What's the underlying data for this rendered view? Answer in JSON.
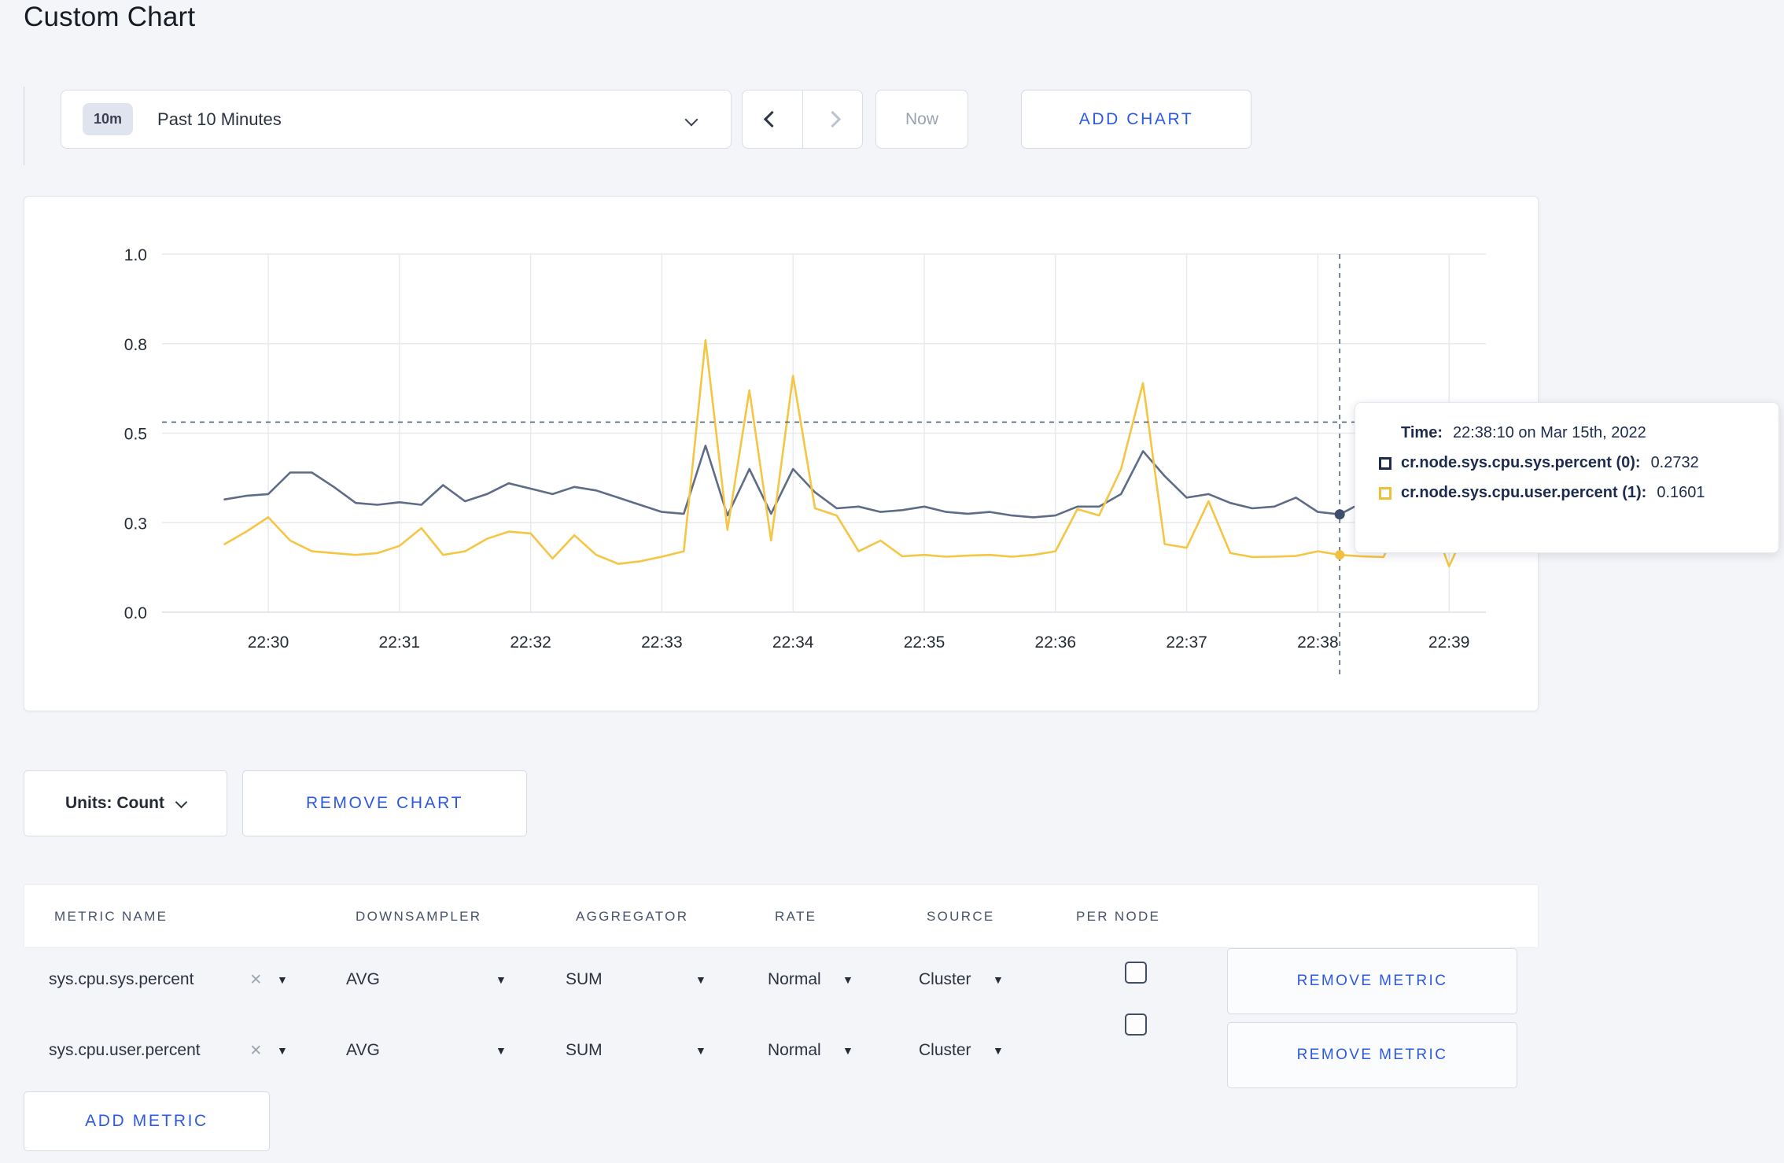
{
  "page": {
    "title": "Custom Chart"
  },
  "toolbar": {
    "time_picker": {
      "badge": "10m",
      "label": "Past 10 Minutes"
    },
    "now_label": "Now",
    "add_chart_label": "ADD CHART"
  },
  "chart_controls": {
    "units_label": "Units: Count",
    "remove_chart_label": "REMOVE CHART"
  },
  "icons": {
    "caret_down": "▼",
    "close": "×"
  },
  "metrics_table": {
    "headers": [
      "METRIC NAME",
      "DOWNSAMPLER",
      "AGGREGATOR",
      "RATE",
      "SOURCE",
      "PER NODE"
    ],
    "rows": [
      {
        "metric": "sys.cpu.sys.percent",
        "downsampler": "AVG",
        "aggregator": "SUM",
        "rate": "Normal",
        "source": "Cluster",
        "per_node_checked": false,
        "remove_label": "REMOVE METRIC"
      },
      {
        "metric": "sys.cpu.user.percent",
        "downsampler": "AVG",
        "aggregator": "SUM",
        "rate": "Normal",
        "source": "Cluster",
        "per_node_checked": false,
        "remove_label": "REMOVE METRIC"
      }
    ],
    "add_metric_label": "ADD METRIC"
  },
  "chart_data": {
    "type": "line",
    "title": "",
    "xlabel": "",
    "ylabel": "",
    "ylim": [
      0,
      1
    ],
    "grid": true,
    "legend_position": "tooltip-only",
    "x_unit": "minutes after 22:30",
    "x_range": [
      "22:29:40",
      "22:39:10"
    ],
    "y_ticks": [
      {
        "v": 0.0,
        "label": "0.0"
      },
      {
        "v": 0.25,
        "label": "0.3"
      },
      {
        "v": 0.5,
        "label": "0.5"
      },
      {
        "v": 0.75,
        "label": "0.8"
      },
      {
        "v": 1.0,
        "label": "1.0"
      }
    ],
    "x_ticks": [
      {
        "t": 0,
        "label": "22:30"
      },
      {
        "t": 1,
        "label": "22:31"
      },
      {
        "t": 2,
        "label": "22:32"
      },
      {
        "t": 3,
        "label": "22:33"
      },
      {
        "t": 4,
        "label": "22:34"
      },
      {
        "t": 5,
        "label": "22:35"
      },
      {
        "t": 6,
        "label": "22:36"
      },
      {
        "t": 7,
        "label": "22:37"
      },
      {
        "t": 8,
        "label": "22:38"
      },
      {
        "t": 9,
        "label": "22:39"
      }
    ],
    "series": [
      {
        "name": "cr.node.sys.cpu.sys.percent (0)",
        "color": "#5e6c87",
        "points": [
          [
            -0.333,
            0.315
          ],
          [
            -0.167,
            0.325
          ],
          [
            0,
            0.33
          ],
          [
            0.167,
            0.39
          ],
          [
            0.333,
            0.39
          ],
          [
            0.5,
            0.35
          ],
          [
            0.667,
            0.305
          ],
          [
            0.833,
            0.3
          ],
          [
            1,
            0.307
          ],
          [
            1.167,
            0.3
          ],
          [
            1.333,
            0.355
          ],
          [
            1.5,
            0.31
          ],
          [
            1.667,
            0.33
          ],
          [
            1.833,
            0.36
          ],
          [
            2,
            0.345
          ],
          [
            2.167,
            0.33
          ],
          [
            2.333,
            0.35
          ],
          [
            2.5,
            0.34
          ],
          [
            2.667,
            0.32
          ],
          [
            2.833,
            0.3
          ],
          [
            3,
            0.28
          ],
          [
            3.167,
            0.275
          ],
          [
            3.333,
            0.465
          ],
          [
            3.5,
            0.27
          ],
          [
            3.667,
            0.4
          ],
          [
            3.833,
            0.275
          ],
          [
            4,
            0.4
          ],
          [
            4.167,
            0.335
          ],
          [
            4.333,
            0.29
          ],
          [
            4.5,
            0.295
          ],
          [
            4.667,
            0.28
          ],
          [
            4.833,
            0.285
          ],
          [
            5,
            0.295
          ],
          [
            5.167,
            0.28
          ],
          [
            5.333,
            0.275
          ],
          [
            5.5,
            0.28
          ],
          [
            5.667,
            0.27
          ],
          [
            5.833,
            0.265
          ],
          [
            6,
            0.27
          ],
          [
            6.167,
            0.295
          ],
          [
            6.333,
            0.295
          ],
          [
            6.5,
            0.33
          ],
          [
            6.667,
            0.45
          ],
          [
            6.833,
            0.38
          ],
          [
            7,
            0.32
          ],
          [
            7.167,
            0.33
          ],
          [
            7.333,
            0.305
          ],
          [
            7.5,
            0.29
          ],
          [
            7.667,
            0.295
          ],
          [
            7.833,
            0.32
          ],
          [
            8,
            0.28
          ],
          [
            8.167,
            0.2732
          ],
          [
            8.333,
            0.305
          ],
          [
            8.5,
            0.295
          ],
          [
            8.667,
            0.29
          ],
          [
            8.833,
            0.295
          ],
          [
            9,
            0.295
          ],
          [
            9.167,
            0.3
          ]
        ]
      },
      {
        "name": "cr.node.sys.cpu.user.percent (1)",
        "color": "#f5c544",
        "points": [
          [
            -0.333,
            0.19
          ],
          [
            -0.167,
            0.225
          ],
          [
            0,
            0.265
          ],
          [
            0.167,
            0.2
          ],
          [
            0.333,
            0.17
          ],
          [
            0.5,
            0.165
          ],
          [
            0.667,
            0.16
          ],
          [
            0.833,
            0.165
          ],
          [
            1,
            0.185
          ],
          [
            1.167,
            0.235
          ],
          [
            1.333,
            0.16
          ],
          [
            1.5,
            0.17
          ],
          [
            1.667,
            0.205
          ],
          [
            1.833,
            0.225
          ],
          [
            2,
            0.22
          ],
          [
            2.167,
            0.15
          ],
          [
            2.333,
            0.215
          ],
          [
            2.5,
            0.16
          ],
          [
            2.667,
            0.135
          ],
          [
            2.833,
            0.142
          ],
          [
            3,
            0.155
          ],
          [
            3.167,
            0.17
          ],
          [
            3.333,
            0.76
          ],
          [
            3.5,
            0.23
          ],
          [
            3.667,
            0.62
          ],
          [
            3.833,
            0.2
          ],
          [
            4,
            0.66
          ],
          [
            4.167,
            0.29
          ],
          [
            4.333,
            0.27
          ],
          [
            4.5,
            0.17
          ],
          [
            4.667,
            0.2
          ],
          [
            4.833,
            0.156
          ],
          [
            5,
            0.16
          ],
          [
            5.167,
            0.155
          ],
          [
            5.333,
            0.158
          ],
          [
            5.5,
            0.16
          ],
          [
            5.667,
            0.155
          ],
          [
            5.833,
            0.16
          ],
          [
            6,
            0.17
          ],
          [
            6.167,
            0.288
          ],
          [
            6.333,
            0.27
          ],
          [
            6.5,
            0.4
          ],
          [
            6.667,
            0.64
          ],
          [
            6.833,
            0.19
          ],
          [
            7,
            0.18
          ],
          [
            7.167,
            0.31
          ],
          [
            7.333,
            0.165
          ],
          [
            7.5,
            0.154
          ],
          [
            7.667,
            0.155
          ],
          [
            7.833,
            0.157
          ],
          [
            8,
            0.17
          ],
          [
            8.167,
            0.1601
          ],
          [
            8.333,
            0.156
          ],
          [
            8.5,
            0.154
          ],
          [
            8.667,
            0.28
          ],
          [
            8.833,
            0.295
          ],
          [
            9,
            0.128
          ],
          [
            9.167,
            0.26
          ]
        ]
      }
    ],
    "crosshair": {
      "t": 8.1667,
      "hline_value": 0.531,
      "markers": [
        {
          "v": 0.2732,
          "color": "#3e4e6c",
          "r": 6.5
        },
        {
          "v": 0.1601,
          "color": "#f1c13e",
          "r": 6
        }
      ]
    },
    "tooltip": {
      "time_label": "Time:",
      "time_value": "22:38:10 on Mar 15th, 2022",
      "entries": [
        {
          "name": "cr.node.sys.cpu.sys.percent (0):",
          "value": "0.2732"
        },
        {
          "name": "cr.node.sys.cpu.user.percent (1):",
          "value": "0.1601"
        }
      ]
    }
  }
}
